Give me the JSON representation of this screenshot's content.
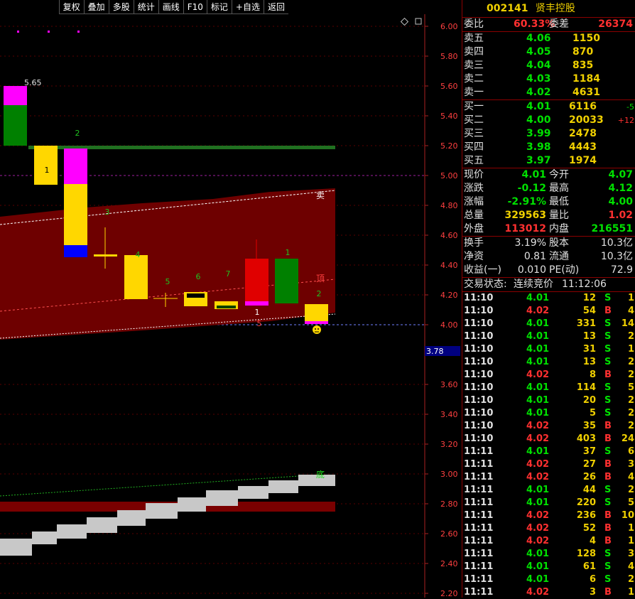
{
  "toolbar": [
    "复权",
    "叠加",
    "多股",
    "统计",
    "画线",
    "F10",
    "标记",
    "+自选",
    "返回"
  ],
  "chart": {
    "price_ticks": [
      "6.00",
      "5.80",
      "5.60",
      "5.40",
      "5.20",
      "5.00",
      "4.80",
      "4.60",
      "4.40",
      "4.20",
      "4.00",
      "3.60",
      "3.40",
      "3.20",
      "3.00",
      "2.80",
      "2.60",
      "2.40",
      "2.20"
    ],
    "price_tag": "3.78",
    "peak_label": "5.65",
    "markers": {
      "sell": "卖",
      "top": "顶",
      "bottom_flag": "底",
      "low_mark": "5",
      "num1": "1",
      "num2": "2",
      "num3": "3",
      "num4": "4",
      "num5": "5",
      "num6": "6",
      "num7": "7",
      "num1b": "1",
      "num2b": "2",
      "num1c": "1"
    }
  },
  "stock": {
    "code": "002141",
    "name": "贤丰控股"
  },
  "order_ratio": {
    "label_ratio": "委比",
    "ratio": "60.33%",
    "label_diff": "委差",
    "diff": "26374"
  },
  "asks": [
    {
      "label": "卖五",
      "price": "4.06",
      "vol": "1150"
    },
    {
      "label": "卖四",
      "price": "4.05",
      "vol": "870"
    },
    {
      "label": "卖三",
      "price": "4.04",
      "vol": "835"
    },
    {
      "label": "卖二",
      "price": "4.03",
      "vol": "1184"
    },
    {
      "label": "卖一",
      "price": "4.02",
      "vol": "4631"
    }
  ],
  "bids": [
    {
      "label": "买一",
      "price": "4.01",
      "vol": "6116",
      "chg": "-5"
    },
    {
      "label": "买二",
      "price": "4.00",
      "vol": "20033",
      "chg": "+12"
    },
    {
      "label": "买三",
      "price": "3.99",
      "vol": "2478",
      "chg": ""
    },
    {
      "label": "买四",
      "price": "3.98",
      "vol": "4443",
      "chg": ""
    },
    {
      "label": "买五",
      "price": "3.97",
      "vol": "1974",
      "chg": ""
    }
  ],
  "quote": [
    {
      "l1": "现价",
      "v1": "4.01",
      "c1": "g",
      "l2": "今开",
      "v2": "4.07",
      "c2": "g"
    },
    {
      "l1": "涨跌",
      "v1": "-0.12",
      "c1": "g",
      "l2": "最高",
      "v2": "4.12",
      "c2": "g"
    },
    {
      "l1": "涨幅",
      "v1": "-2.91%",
      "c1": "g",
      "l2": "最低",
      "v2": "4.00",
      "c2": "g"
    },
    {
      "l1": "总量",
      "v1": "329563",
      "c1": "y",
      "l2": "量比",
      "v2": "1.02",
      "c2": "r"
    },
    {
      "l1": "外盘",
      "v1": "113012",
      "c1": "r",
      "l2": "内盘",
      "v2": "216551",
      "c2": "g"
    }
  ],
  "fundamentals": [
    {
      "l1": "换手",
      "v1": "3.19%",
      "l2": "股本",
      "v2": "10.3亿"
    },
    {
      "l1": "净资",
      "v1": "0.81",
      "l2": "流通",
      "v2": "10.3亿"
    },
    {
      "l1": "收益(一)",
      "v1": "0.010",
      "l2": "PE(动)",
      "v2": "72.9"
    }
  ],
  "trade_status": {
    "label": "交易状态:",
    "value": "连续竞价",
    "time": "11:12:06"
  },
  "ticks": [
    {
      "t": "11:10",
      "p": "4.01",
      "v": "12",
      "s": "S",
      "n": "1"
    },
    {
      "t": "11:10",
      "p": "4.02",
      "v": "54",
      "s": "B",
      "n": "4"
    },
    {
      "t": "11:10",
      "p": "4.01",
      "v": "331",
      "s": "S",
      "n": "14"
    },
    {
      "t": "11:10",
      "p": "4.01",
      "v": "13",
      "s": "S",
      "n": "2"
    },
    {
      "t": "11:10",
      "p": "4.01",
      "v": "31",
      "s": "S",
      "n": "1"
    },
    {
      "t": "11:10",
      "p": "4.01",
      "v": "13",
      "s": "S",
      "n": "2"
    },
    {
      "t": "11:10",
      "p": "4.02",
      "v": "8",
      "s": "B",
      "n": "2"
    },
    {
      "t": "11:10",
      "p": "4.01",
      "v": "114",
      "s": "S",
      "n": "5"
    },
    {
      "t": "11:10",
      "p": "4.01",
      "v": "20",
      "s": "S",
      "n": "2"
    },
    {
      "t": "11:10",
      "p": "4.01",
      "v": "5",
      "s": "S",
      "n": "2"
    },
    {
      "t": "11:10",
      "p": "4.02",
      "v": "35",
      "s": "B",
      "n": "2"
    },
    {
      "t": "11:10",
      "p": "4.02",
      "v": "403",
      "s": "B",
      "n": "24"
    },
    {
      "t": "11:11",
      "p": "4.01",
      "v": "37",
      "s": "S",
      "n": "6"
    },
    {
      "t": "11:11",
      "p": "4.02",
      "v": "27",
      "s": "B",
      "n": "3"
    },
    {
      "t": "11:11",
      "p": "4.02",
      "v": "26",
      "s": "B",
      "n": "4"
    },
    {
      "t": "11:11",
      "p": "4.01",
      "v": "44",
      "s": "S",
      "n": "2"
    },
    {
      "t": "11:11",
      "p": "4.01",
      "v": "220",
      "s": "S",
      "n": "5"
    },
    {
      "t": "11:11",
      "p": "4.02",
      "v": "236",
      "s": "B",
      "n": "10"
    },
    {
      "t": "11:11",
      "p": "4.02",
      "v": "52",
      "s": "B",
      "n": "1"
    },
    {
      "t": "11:11",
      "p": "4.02",
      "v": "4",
      "s": "B",
      "n": "1"
    },
    {
      "t": "11:11",
      "p": "4.01",
      "v": "128",
      "s": "S",
      "n": "3"
    },
    {
      "t": "11:11",
      "p": "4.01",
      "v": "61",
      "s": "S",
      "n": "4"
    },
    {
      "t": "11:11",
      "p": "4.01",
      "v": "6",
      "s": "S",
      "n": "2"
    },
    {
      "t": "11:11",
      "p": "4.02",
      "v": "3",
      "s": "B",
      "n": "1"
    }
  ],
  "colors": {
    "up": "#ff3030",
    "down": "#00e000",
    "volume": "#f0d000",
    "grid": "#8b0000"
  }
}
